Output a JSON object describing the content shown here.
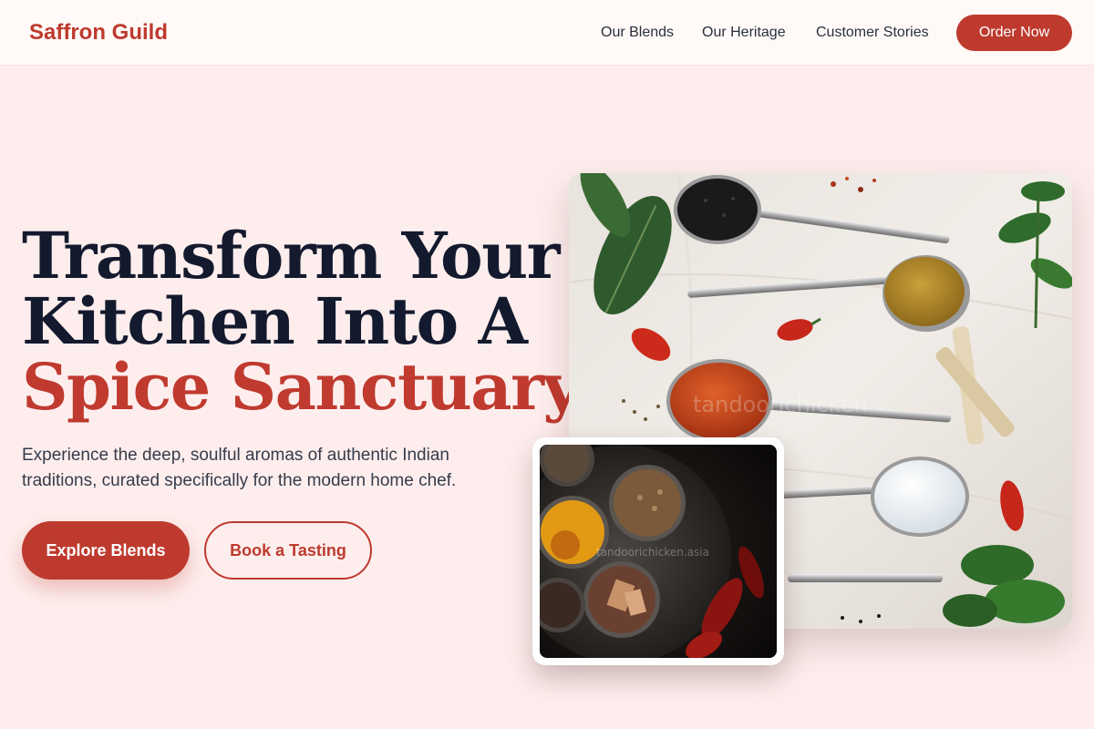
{
  "brand": "Saffron Guild",
  "nav": {
    "links": [
      "Our Blends",
      "Our Heritage",
      "Customer Stories"
    ],
    "cta": "Order Now"
  },
  "hero": {
    "headline_line1": "Transform Your",
    "headline_line2": "Kitchen Into A",
    "headline_accent": "Spice Sanctuary.",
    "subtitle": "Experience the deep, soulful aromas of authentic Indian traditions, curated specifically for the modern home chef.",
    "primary_button": "Explore Blends",
    "secondary_button": "Book a Tasting"
  },
  "images": {
    "main_watermark": "tandoorichicken",
    "inset_watermark": "tandoorichicken.asia"
  },
  "colors": {
    "accent": "#be3a2e",
    "background": "#fdeeed",
    "heading": "#141a2e",
    "nav_background": "#fffaf8"
  }
}
